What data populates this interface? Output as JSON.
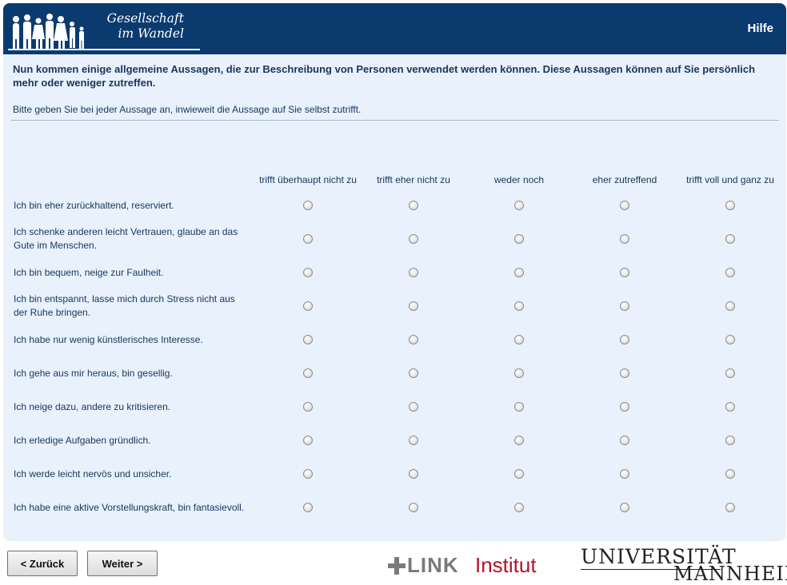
{
  "header": {
    "brand_line1": "Gesellschaft",
    "brand_line2": "im Wandel",
    "help_label": "Hilfe"
  },
  "intro": "Nun kommen einige allgemeine Aussagen, die zur Beschreibung von Personen verwendet werden können. Diese Aussagen können auf Sie persönlich mehr oder weniger zutreffen.",
  "instruction": "Bitte geben Sie bei jeder Aussage an, inwieweit die Aussage auf Sie selbst zutrifft.",
  "columns": [
    "trifft überhaupt nicht zu",
    "trifft eher nicht zu",
    "weder noch",
    "eher zutreffend",
    "trifft voll und ganz zu"
  ],
  "rows": [
    "Ich bin eher zurückhaltend, reserviert.",
    "Ich schenke anderen leicht Vertrauen, glaube an das Gute im Menschen.",
    "Ich bin bequem, neige zur Faulheit.",
    "Ich bin entspannt, lasse mich durch Stress nicht aus der Ruhe bringen.",
    "Ich habe nur wenig künstlerisches Interesse.",
    "Ich gehe aus mir heraus, bin gesellig.",
    "Ich neige dazu, andere zu kritisieren.",
    "Ich erledige Aufgaben gründlich.",
    "Ich werde leicht nervös und unsicher.",
    "Ich habe eine aktive Vorstellungskraft, bin fantasievoll."
  ],
  "footer": {
    "back_label": "< Zurück",
    "next_label": "Weiter >",
    "link_logo_word": "LINK",
    "link_logo_institut": "Institut",
    "university_line1": "UNIVERSITÄT",
    "university_line2": "MANNHEIM"
  },
  "colors": {
    "header_bg": "#0b3a6f",
    "panel_bg": "#e9f1fc",
    "text": "#17365d",
    "link_red": "#b3122a"
  },
  "icons": {
    "logo": "silhouettes-people-icon",
    "link_logo": "link-cross-icon"
  }
}
